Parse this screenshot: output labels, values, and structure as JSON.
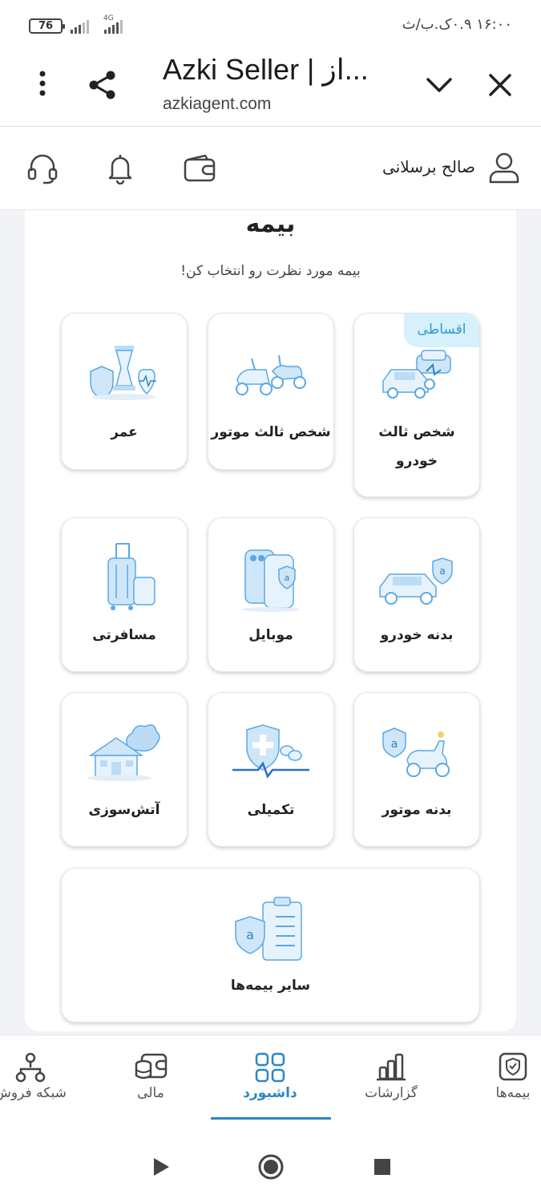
{
  "status_bar": {
    "battery": "76",
    "network": "4G",
    "time": "۱۶:۰۰ ۰.۹ک.ب/ث"
  },
  "browser": {
    "title": "Azki Seller | از...",
    "url": "azkiagent.com"
  },
  "header": {
    "user_name": "صالح برسلانی"
  },
  "section": {
    "title": "بیمه",
    "subtitle": "بیمه مورد نظرت رو انتخاب کن!"
  },
  "insurance_tiles": [
    {
      "label": "شخص ثالث خودرو",
      "badge": "اقساطی",
      "icon": "car-third-party-icon"
    },
    {
      "label": "شخص ثالث موتور",
      "icon": "motorcycle-third-party-icon"
    },
    {
      "label": "عمر",
      "icon": "life-insurance-icon"
    },
    {
      "label": "بدنه خودرو",
      "icon": "car-body-icon"
    },
    {
      "label": "موبایل",
      "icon": "mobile-insurance-icon"
    },
    {
      "label": "مسافرتی",
      "icon": "travel-insurance-icon"
    },
    {
      "label": "بدنه موتور",
      "icon": "motorcycle-body-icon"
    },
    {
      "label": "تکمیلی",
      "icon": "supplementary-health-icon"
    },
    {
      "label": "آتش‌سوزی",
      "icon": "fire-insurance-icon"
    },
    {
      "label": "سایر بیمه‌ها",
      "icon": "other-insurance-icon"
    }
  ],
  "bottom_nav": {
    "items": [
      {
        "label": "بیمه‌ها",
        "icon": "policy-icon"
      },
      {
        "label": "گزارشات",
        "icon": "reports-icon"
      },
      {
        "label": "داشبورد",
        "icon": "dashboard-icon",
        "active": true
      },
      {
        "label": "مالی",
        "icon": "finance-icon"
      },
      {
        "label": "شبکه فروش",
        "icon": "sales-network-icon"
      }
    ]
  },
  "colors": {
    "accent": "#2b86c6",
    "badge_bg": "#d6f1fb",
    "badge_text": "#2b9ad6",
    "illustration": "#7fbfec"
  }
}
